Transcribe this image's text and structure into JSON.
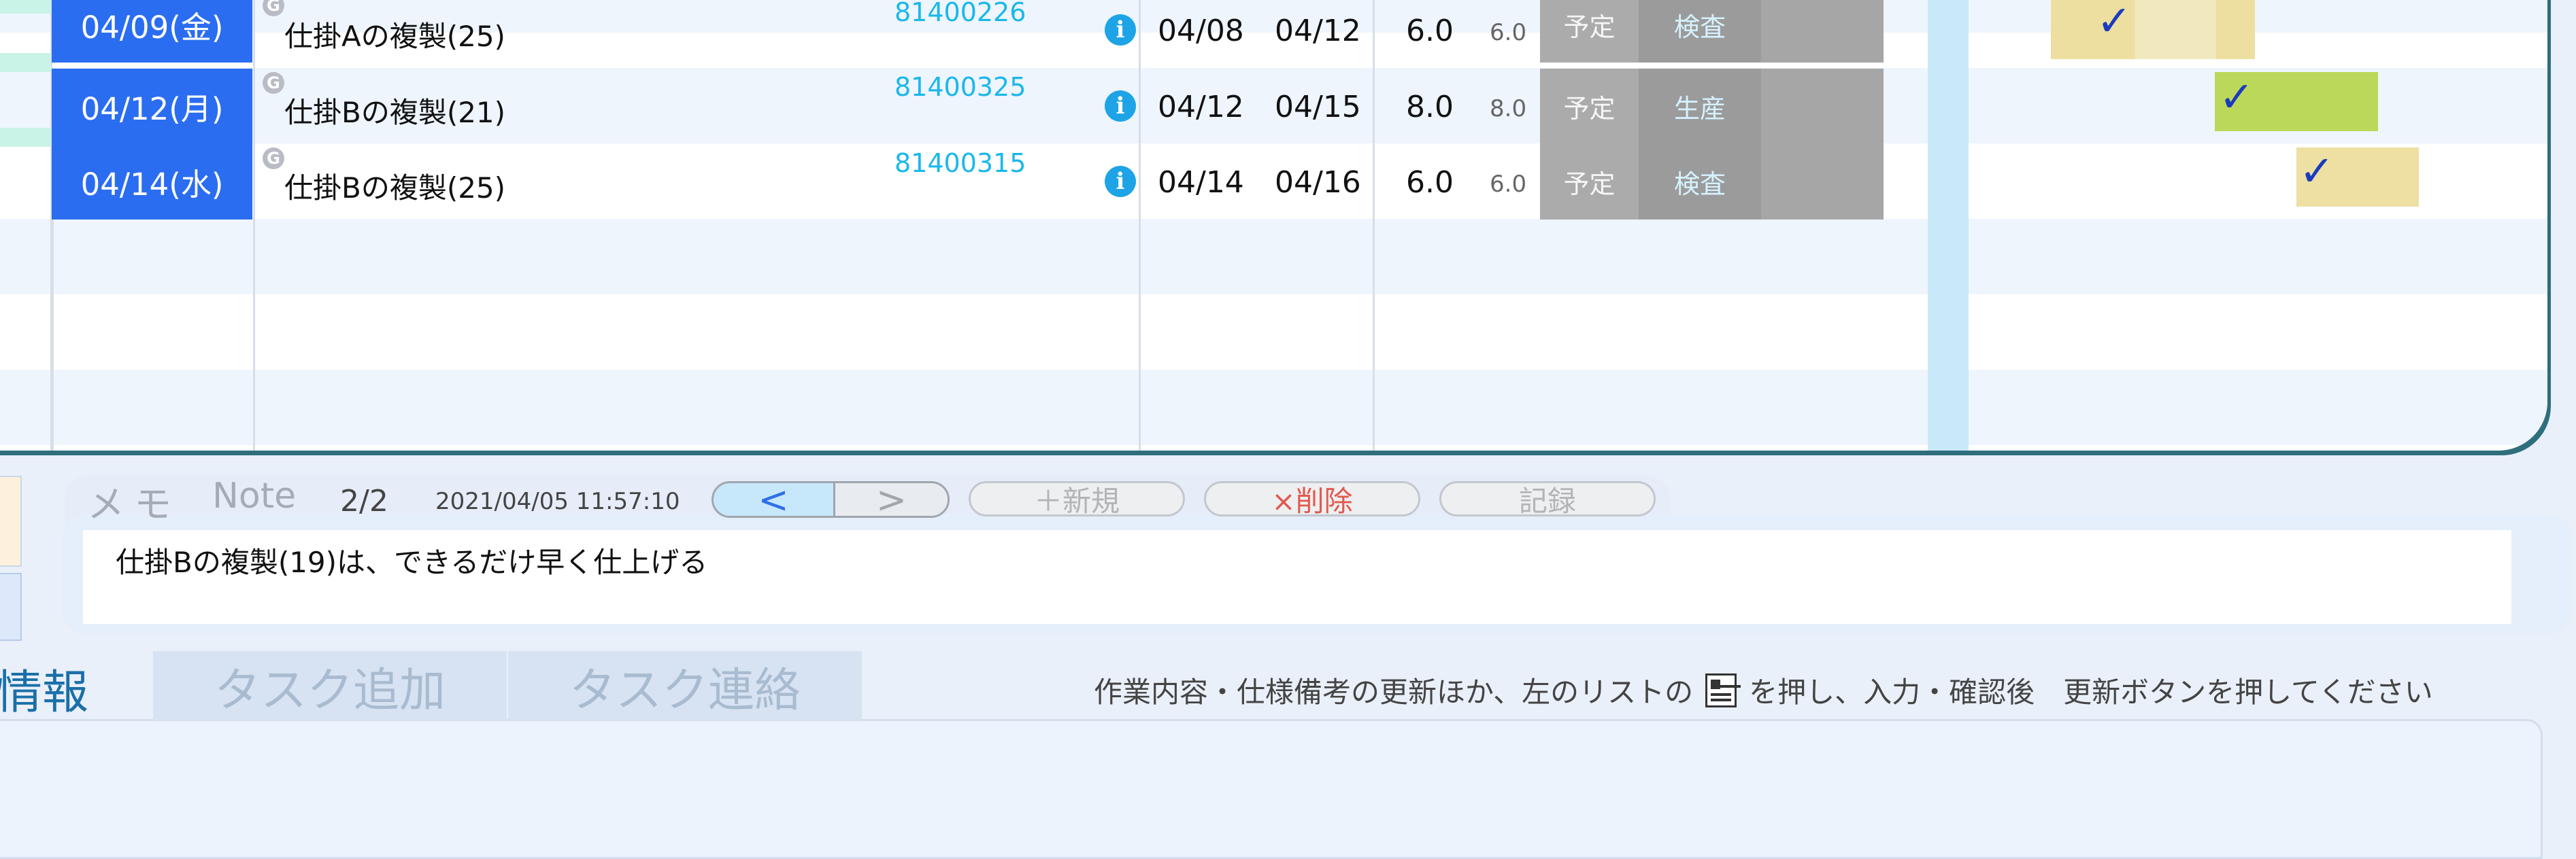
{
  "table": {
    "rows": [
      {
        "date": "04/09(金)",
        "badge": "G",
        "name": "仕掛Aの複製(25)",
        "code": "81400226",
        "info": "i",
        "start": "04/08",
        "end": "04/12",
        "hours": "6.0",
        "hours_small": "6.0",
        "status": "予定",
        "process": "検査"
      },
      {
        "date": "04/12(月)",
        "badge": "G",
        "name": "仕掛Bの複製(21)",
        "code": "81400325",
        "info": "i",
        "start": "04/12",
        "end": "04/15",
        "hours": "8.0",
        "hours_small": "8.0",
        "status": "予定",
        "process": "生産"
      },
      {
        "date": "04/14(水)",
        "badge": "G",
        "name": "仕掛Bの複製(25)",
        "code": "81400315",
        "info": "i",
        "start": "04/14",
        "end": "04/16",
        "hours": "6.0",
        "hours_small": "6.0",
        "status": "予定",
        "process": "検査"
      }
    ],
    "gantt_check": "✓"
  },
  "memo": {
    "label_jp": "メモ",
    "label_en": "Note",
    "page": "2/2",
    "timestamp": "2021/04/05 11:57:10",
    "prev": "<",
    "next": ">",
    "new_label": "＋新規",
    "delete_label": "×削除",
    "save_label": "記録",
    "text": "仕掛Bの複製(19)は、できるだけ早く仕上げる"
  },
  "tabs": {
    "info": "情報",
    "task_add": "タスク追加",
    "task_contact": "タスク連絡"
  },
  "hint": {
    "before": "作業内容・仕様備考の更新ほか、左のリストの",
    "after": "を押し、入力・確認後　更新ボタンを押してください",
    "icon": "document-list-icon"
  },
  "colors": {
    "date_bg": "#2b6df0",
    "code_text": "#1ab8ea",
    "info_icon": "#1ea4e6",
    "status_gray": "#ababab",
    "process_gray": "#9b9b9b",
    "gantt_yellow": "#ede0a2",
    "gantt_green": "#bcd85a",
    "check": "#1a3bbf",
    "tab_active": "#1a6fa8",
    "delete_text": "#e05a4e"
  }
}
